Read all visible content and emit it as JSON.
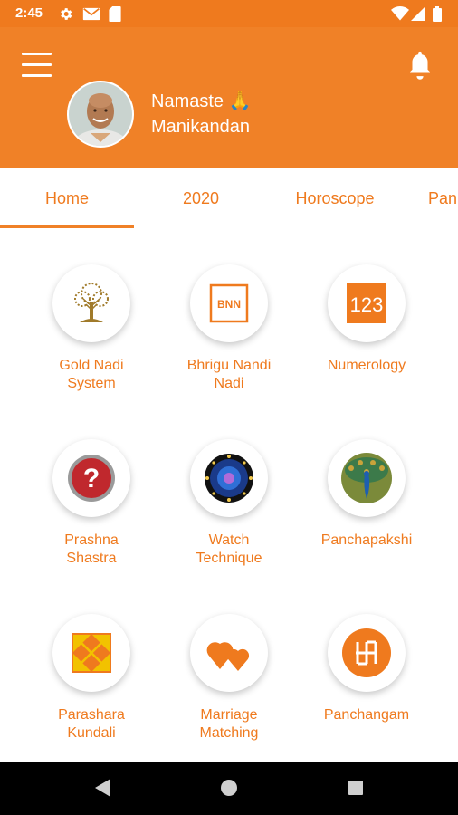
{
  "status_bar": {
    "time": "2:45",
    "left_icons": [
      "settings-icon",
      "gmail-icon",
      "sd-card-icon"
    ],
    "right_icons": [
      "wifi-icon",
      "signal-icon",
      "battery-icon"
    ]
  },
  "header": {
    "background": "#f08127",
    "greeting_line1": "Namaste 🙏",
    "greeting_line2": "Manikandan"
  },
  "tabs": [
    {
      "label": "Home",
      "active": true
    },
    {
      "label": "2020",
      "active": false
    },
    {
      "label": "Horoscope",
      "active": false
    },
    {
      "label": "Pan",
      "active": false
    }
  ],
  "features": [
    {
      "label": "Gold Nadi\nSystem",
      "icon": "tree-icon"
    },
    {
      "label": "Bhrigu Nandi\nNadi",
      "icon": "bnn-icon",
      "icon_text": "BNN"
    },
    {
      "label": "Numerology",
      "icon": "numerology-icon",
      "icon_text": "123"
    },
    {
      "label": "Prashna\nShastra",
      "icon": "question-icon",
      "icon_text": "?"
    },
    {
      "label": "Watch\nTechnique",
      "icon": "cosmic-watch-icon"
    },
    {
      "label": "Panchapakshi",
      "icon": "peacock-icon"
    },
    {
      "label": "Parashara\nKundali",
      "icon": "kundali-chart-icon"
    },
    {
      "label": "Marriage\nMatching",
      "icon": "hearts-icon"
    },
    {
      "label": "Panchangam",
      "icon": "swastika-icon"
    }
  ],
  "accent_color": "#ef7a1e",
  "nav_bar": [
    "back-icon",
    "home-icon",
    "recents-icon"
  ]
}
